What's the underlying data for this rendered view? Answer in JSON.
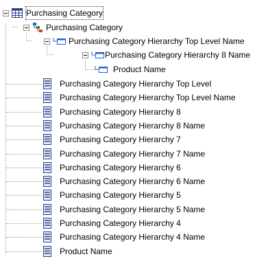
{
  "tree": {
    "root": {
      "label": "Purchasing Category",
      "icon": "dimension-table-icon"
    },
    "hierarchy": {
      "label": "Purchasing Category",
      "icon": "hierarchy-icon"
    },
    "levels": [
      {
        "label": "Purchasing Category Hierarchy Top Level Name",
        "icon": "level-icon"
      },
      {
        "label": "Purchasing Category Hierarchy 8 Name",
        "icon": "level-icon"
      },
      {
        "label": "Product Name",
        "icon": "level-icon"
      }
    ],
    "attributes": [
      {
        "label": "Purchasing Category Hierarchy Top Level"
      },
      {
        "label": "Purchasing Category Hierarchy Top Level Name"
      },
      {
        "label": "Purchasing Category Hierarchy 8"
      },
      {
        "label": "Purchasing Category Hierarchy 8 Name"
      },
      {
        "label": "Purchasing Category Hierarchy 7"
      },
      {
        "label": "Purchasing Category Hierarchy 7 Name"
      },
      {
        "label": "Purchasing Category Hierarchy 6"
      },
      {
        "label": "Purchasing Category Hierarchy 6 Name"
      },
      {
        "label": "Purchasing Category Hierarchy 5"
      },
      {
        "label": "Purchasing Category Hierarchy 5 Name"
      },
      {
        "label": "Purchasing Category Hierarchy 4"
      },
      {
        "label": "Purchasing Category Hierarchy 4 Name"
      },
      {
        "label": "Product Name"
      }
    ],
    "attribute_icon": "attribute-icon"
  },
  "colors": {
    "icon_blue": "#1f5fd0",
    "icon_navy": "#2b3a8c",
    "connector": "#9a9a9a"
  }
}
